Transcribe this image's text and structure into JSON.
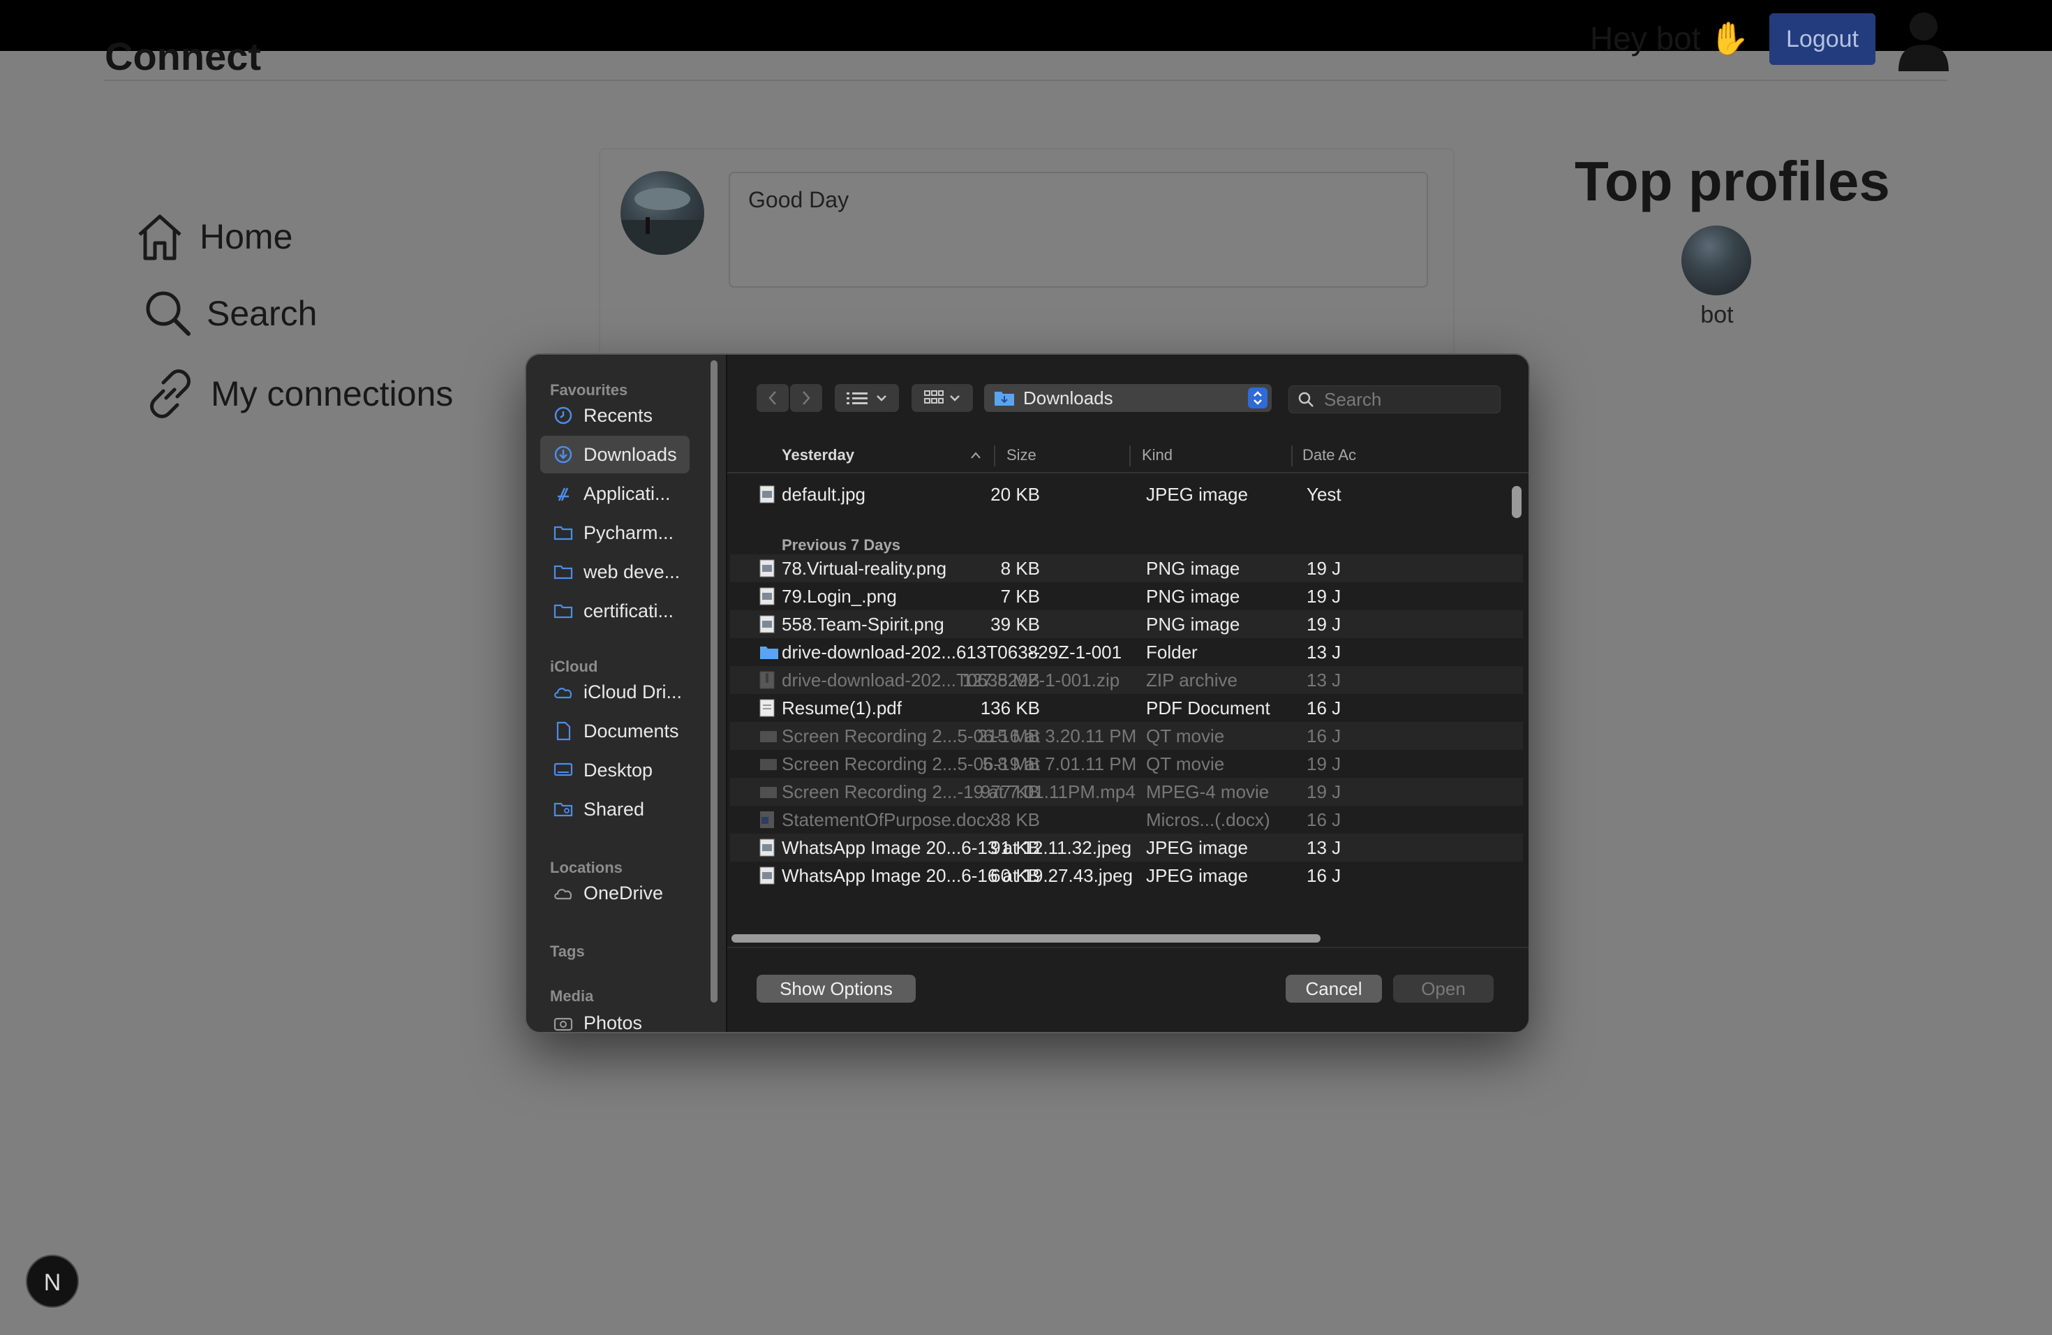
{
  "app": {
    "brand": "Connect",
    "greeting": "Hey bot ✋",
    "logout_label": "Logout"
  },
  "nav": [
    {
      "label": "Home",
      "icon": "home-icon"
    },
    {
      "label": "Search",
      "icon": "search-icon"
    },
    {
      "label": "My connections",
      "icon": "link-icon"
    }
  ],
  "post": {
    "text": "Good Day"
  },
  "top_profiles": {
    "title": "Top profiles",
    "items": [
      {
        "name": "bot"
      }
    ]
  },
  "dialog": {
    "sidebar": {
      "favourites_label": "Favourites",
      "favourites": [
        {
          "label": "Recents",
          "icon": "clock-icon"
        },
        {
          "label": "Downloads",
          "icon": "download-icon",
          "selected": true
        },
        {
          "label": "Applicati...",
          "icon": "applications-icon"
        },
        {
          "label": "Pycharm...",
          "icon": "folder-icon"
        },
        {
          "label": "web deve...",
          "icon": "folder-icon"
        },
        {
          "label": "certificati...",
          "icon": "folder-icon"
        }
      ],
      "icloud_label": "iCloud",
      "icloud": [
        {
          "label": "iCloud Dri...",
          "icon": "cloud-icon"
        },
        {
          "label": "Documents",
          "icon": "document-icon"
        },
        {
          "label": "Desktop",
          "icon": "desktop-icon"
        },
        {
          "label": "Shared",
          "icon": "shared-folder-icon"
        }
      ],
      "locations_label": "Locations",
      "locations": [
        {
          "label": "OneDrive",
          "icon": "cloud-icon"
        }
      ],
      "tags_label": "Tags",
      "media_label": "Media",
      "media": [
        {
          "label": "Photos",
          "icon": "camera-icon"
        }
      ]
    },
    "location": "Downloads",
    "search_placeholder": "Search",
    "columns": {
      "name": "Yesterday",
      "size": "Size",
      "kind": "Kind",
      "date": "Date Ac"
    },
    "groups": [
      {
        "label": "",
        "files": [
          {
            "name": "default.jpg",
            "size": "20 KB",
            "kind": "JPEG image",
            "date": "Yest",
            "dim": false,
            "type": "image"
          }
        ]
      },
      {
        "label": "Previous 7 Days",
        "files": [
          {
            "name": "78.Virtual-reality.png",
            "size": "8 KB",
            "kind": "PNG image",
            "date": "19 J",
            "dim": false,
            "type": "image"
          },
          {
            "name": "79.Login_.png",
            "size": "7 KB",
            "kind": "PNG image",
            "date": "19 J",
            "dim": false,
            "type": "image"
          },
          {
            "name": "558.Team-Spirit.png",
            "size": "39 KB",
            "kind": "PNG image",
            "date": "19 J",
            "dim": false,
            "type": "image"
          },
          {
            "name": "drive-download-202...613T063829Z-1-001",
            "size": "--",
            "kind": "Folder",
            "date": "13 J",
            "dim": false,
            "type": "folder"
          },
          {
            "name": "drive-download-202...T063829Z-1-001.zip",
            "size": "127.5 MB",
            "kind": "ZIP archive",
            "date": "13 J",
            "dim": true,
            "type": "zip"
          },
          {
            "name": "Resume(1).pdf",
            "size": "136 KB",
            "kind": "PDF Document",
            "date": "16 J",
            "dim": false,
            "type": "pdf"
          },
          {
            "name": "Screen Recording 2...5-06-16 at 3.20.11 PM",
            "size": "215 MB",
            "kind": "QT movie",
            "date": "16 J",
            "dim": true,
            "type": "movie"
          },
          {
            "name": "Screen Recording 2...5-06-19 at 7.01.11 PM",
            "size": "5.8 MB",
            "kind": "QT movie",
            "date": "19 J",
            "dim": true,
            "type": "movie"
          },
          {
            "name": "Screen Recording 2...-19 at 7.01.11PM.mp4",
            "size": "977 KB",
            "kind": "MPEG-4 movie",
            "date": "19 J",
            "dim": true,
            "type": "movie"
          },
          {
            "name": "StatementOfPurpose.docx",
            "size": "38 KB",
            "kind": "Micros...(.docx)",
            "date": "16 J",
            "dim": true,
            "type": "doc"
          },
          {
            "name": "WhatsApp Image 20...6-13 at 12.11.32.jpeg",
            "size": "91 KB",
            "kind": "JPEG image",
            "date": "13 J",
            "dim": false,
            "type": "image"
          },
          {
            "name": "WhatsApp Image 20...6-16 at 19.27.43.jpeg",
            "size": "60 KB",
            "kind": "JPEG image",
            "date": "16 J",
            "dim": false,
            "type": "image"
          }
        ]
      }
    ],
    "buttons": {
      "show_options": "Show Options",
      "cancel": "Cancel",
      "open": "Open"
    }
  },
  "badge": {
    "letter": "N"
  }
}
